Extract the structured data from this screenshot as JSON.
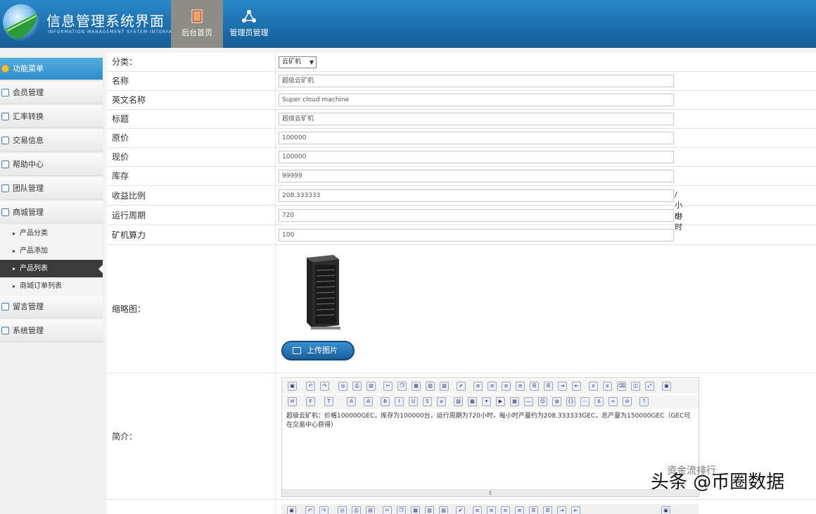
{
  "header": {
    "title": "信息管理系统界面",
    "subtitle": "INFORMATION MANAGEMENT SYSTEM INTERFACE",
    "tabs": [
      {
        "label": "后台首页",
        "icon": "book-icon"
      },
      {
        "label": "管理员管理",
        "icon": "network-icon"
      }
    ]
  },
  "sidebar": {
    "items": [
      {
        "label": "功能菜单"
      },
      {
        "label": "会员管理"
      },
      {
        "label": "汇率转换"
      },
      {
        "label": "交易信息"
      },
      {
        "label": "帮助中心"
      },
      {
        "label": "团队管理"
      },
      {
        "label": "商城管理"
      }
    ],
    "sub_items": [
      {
        "label": "产品分类"
      },
      {
        "label": "产品添加"
      },
      {
        "label": "产品列表"
      },
      {
        "label": "商城订单列表"
      }
    ],
    "bottom_items": [
      {
        "label": "留言管理"
      },
      {
        "label": "系统管理"
      }
    ]
  },
  "form": {
    "category": {
      "label": "分类：",
      "value": "云矿机"
    },
    "name": {
      "label": "名称",
      "value": "超级云矿机"
    },
    "en_name": {
      "label": "英文名称",
      "value": "Super cloud machine"
    },
    "title": {
      "label": "标题",
      "value": "超级云矿机"
    },
    "orig_price": {
      "label": "原价",
      "value": "100000"
    },
    "cur_price": {
      "label": "现价",
      "value": "100000"
    },
    "stock": {
      "label": "库存",
      "value": "99999"
    },
    "yield": {
      "label": "收益比例",
      "value": "208.333333",
      "unit": "/小时"
    },
    "cycle": {
      "label": "运行周期",
      "value": "720",
      "unit": "小时"
    },
    "power": {
      "label": "矿机算力",
      "value": "100"
    },
    "thumbnail": {
      "label": "缩略图：",
      "upload_label": "上传图片"
    },
    "intro": {
      "label": "简介：",
      "text": "超级云矿机：价格100000GEC，库存为100000台，运行周期为720小时，每小时产量约为208.333333GEC，总产量为150000GEC（GEC可在交易中心获得）",
      "resize": "⇕"
    }
  },
  "watermark": {
    "main": "头条 @币圈数据",
    "sub": "资金流排行"
  }
}
